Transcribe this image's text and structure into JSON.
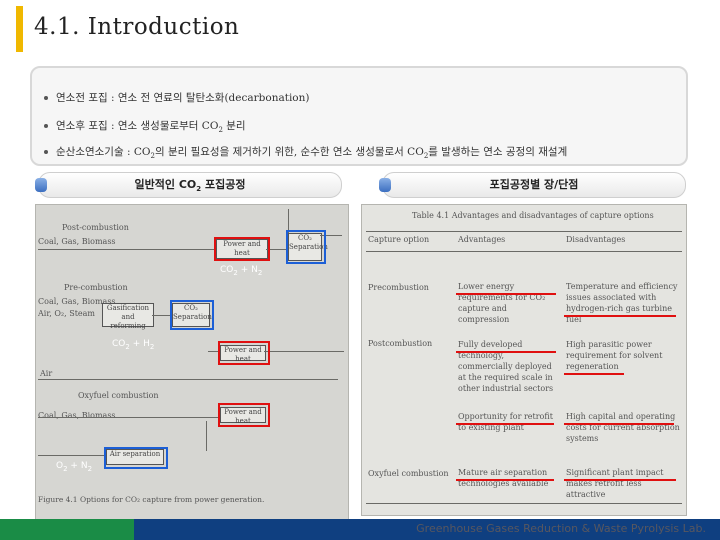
{
  "header": {
    "title": "4.1. Introduction"
  },
  "bullets": [
    {
      "text": "연소전 포집 : 연소 전 연료의 탈탄소화(decarbonation)"
    },
    {
      "text_pre": "연소후 포집 : 연소 생성물로부터 CO",
      "sub": "2",
      "text_post": " 분리"
    },
    {
      "text_pre": "순산소연소기술 : CO",
      "sub": "2",
      "text_mid": "의 분리 필요성을 제거하기 위한, 순수한 연소 생성물로서 CO",
      "sub2": "2",
      "text_post": "를 발생하는 연소 공정의 재설계"
    }
  ],
  "left_section": {
    "title_pre": "일반적인 CO",
    "title_sub": "2",
    "title_post": " 포집공정",
    "figure": {
      "caption": "Figure 4.1 Options for CO₂ capture from power generation.",
      "rows": [
        {
          "heading": "Post-combustion",
          "input": "Coal, Gas, Biomass"
        },
        {
          "heading": "Pre-combustion",
          "input": "Coal, Gas, Biomass"
        },
        {
          "heading": "Oxyfuel combustion",
          "input": "Coal, Gas, Biomass"
        }
      ],
      "annotations": [
        {
          "pre": "CO",
          "sub": "2",
          "post": " + N",
          "sub2": "2"
        },
        {
          "pre": "CO",
          "sub": "2",
          "post": " + H",
          "sub2": "2"
        },
        {
          "pre": "O",
          "sub": "2",
          "post": " + N",
          "sub2": "2"
        }
      ],
      "boxes": {
        "power_heat": "Power and heat",
        "co2_separation": "CO₂ Separation",
        "gasification": "Gasification and reforming",
        "air_separation": "Air separation",
        "air_o2_steam": "Air, O₂, Steam",
        "air": "Air"
      }
    }
  },
  "right_section": {
    "title": "포집공정별 장/단점",
    "table": {
      "caption": "Table 4.1 Advantages and disadvantages of capture options",
      "headers": [
        "Capture option",
        "Advantages",
        "Disadvantages"
      ],
      "rows": [
        {
          "option": "Precombustion",
          "advantages": "Lower energy requirements for CO₂ capture and compression",
          "disadvantages": "Temperature and efficiency issues associated with hydrogen-rich gas turbine fuel"
        },
        {
          "option": "Postcombustion",
          "advantages": "Fully developed technology, commercially deployed at the required scale in other industrial sectors",
          "disadvantages": "High parasitic power requirement for solvent regeneration"
        },
        {
          "option": "",
          "advantages": "Opportunity for retrofit to existing plant",
          "disadvantages": "High capital and operating costs for current absorption systems"
        },
        {
          "option": "Oxyfuel combustion",
          "advantages": "Mature air separation technologies available",
          "disadvantages": "Significant plant impact makes retrofit less attractive"
        }
      ]
    }
  },
  "footer": {
    "text": "Greenhouse Gases Reduction & Waste Pyrolysis Lab.",
    "accent_green": "#1a8c46",
    "accent_blue": "#0f3f80"
  },
  "colors": {
    "title_bar": "#f0b800",
    "highlight_red": "#e01010",
    "highlight_blue": "#1c5fd6"
  }
}
